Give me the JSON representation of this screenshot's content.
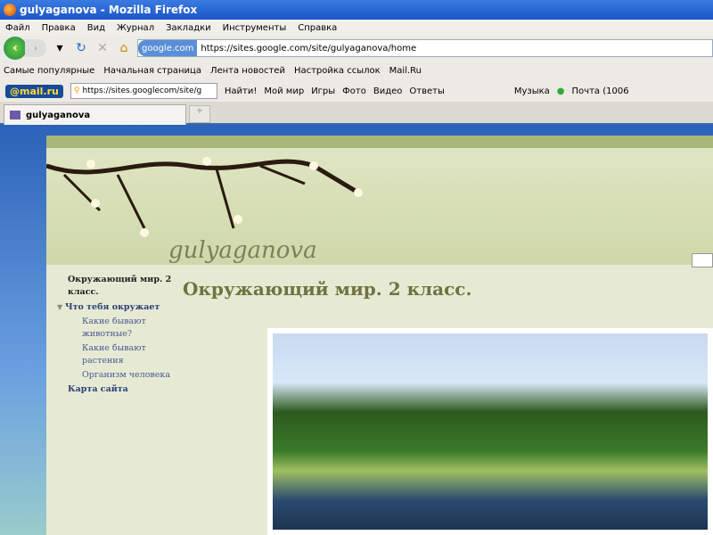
{
  "window": {
    "title": "gulyaganova - Mozilla Firefox"
  },
  "menu": [
    "Файл",
    "Правка",
    "Вид",
    "Журнал",
    "Закладки",
    "Инструменты",
    "Справка"
  ],
  "nav": {
    "identity": "google.com",
    "url": "https://sites.google.com/site/gulyaganova/home"
  },
  "bookmarks": [
    "Самые популярные",
    "Начальная страница",
    "Лента новостей",
    "Настройка ссылок",
    "Mail.Ru"
  ],
  "mailbar": {
    "logo": "@mail.ru",
    "search_value": "https://sites.googlecom/site/g",
    "find": "Найти!",
    "items": [
      "Мой мир",
      "Игры",
      "Фото",
      "Видео",
      "Ответы"
    ],
    "music": "Музыка",
    "mail": "Почта (1006"
  },
  "tab": {
    "label": "gulyaganova",
    "new": "+"
  },
  "site": {
    "name": "gulyaganova",
    "heading": "Окружающий мир. 2 класс.",
    "sidebar": {
      "current": "Окружающий мир. 2 класс.",
      "section": "Что тебя окружает",
      "subs": [
        "Какие бывают животные?",
        "Какие бывают растения",
        "Организм человека"
      ],
      "sitemap": "Карта сайта"
    }
  }
}
